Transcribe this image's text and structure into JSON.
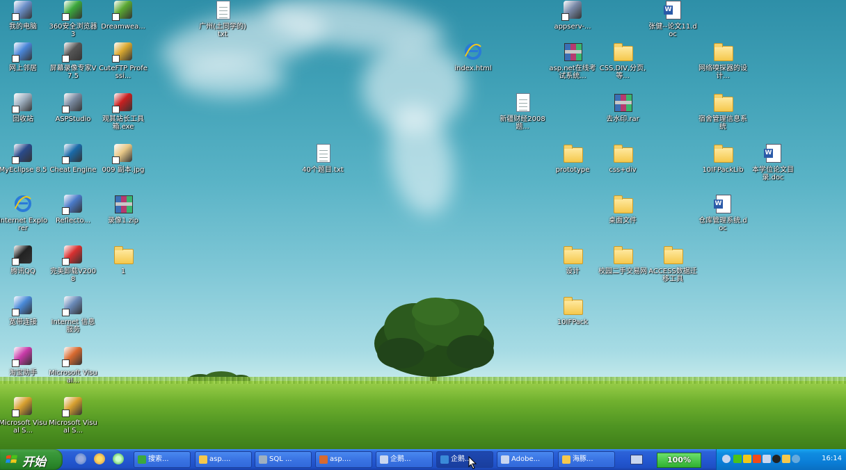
{
  "desktop": {
    "icons": [
      {
        "label": "我的电脑",
        "kind": "generic",
        "color": "#6b8fc9"
      },
      {
        "label": "360安全浏览器 3",
        "kind": "generic",
        "color": "#3ca83c"
      },
      {
        "label": "Dreamwea...",
        "kind": "generic",
        "color": "#5aa832"
      },
      {
        "label": "广州(土同学的) txt",
        "kind": "doc"
      },
      {
        "label": "appserv-...",
        "kind": "generic",
        "color": "#7a8aa8"
      },
      {
        "label": "张健--论文11.doc",
        "kind": "worddoc"
      },
      {
        "label": "网上邻居",
        "kind": "generic",
        "color": "#4a86d8"
      },
      {
        "label": "屏幕录像专家V7.5",
        "kind": "generic",
        "color": "#555555"
      },
      {
        "label": "CuteFTP Professi...",
        "kind": "generic",
        "color": "#d9a830"
      },
      {
        "label": "index.html",
        "kind": "ie"
      },
      {
        "label": "asp.net在线考试系统...",
        "kind": "rar"
      },
      {
        "label": "CSS,DIV,分页,等...",
        "kind": "folder"
      },
      {
        "label": "网络嗅探器的设计...",
        "kind": "folder"
      },
      {
        "label": "回收站",
        "kind": "generic",
        "color": "#9fb0c0"
      },
      {
        "label": "ASPStudio",
        "kind": "generic",
        "color": "#7a8aa0"
      },
      {
        "label": "观其站长工具箱.exe",
        "kind": "generic",
        "color": "#c82020"
      },
      {
        "label": "新疆财经2008题...",
        "kind": "doc"
      },
      {
        "label": "去水印.rar",
        "kind": "rar"
      },
      {
        "label": "宿舍管理信息系统",
        "kind": "folder"
      },
      {
        "label": "MyEclipse 8.5",
        "kind": "generic",
        "color": "#2a4a8a"
      },
      {
        "label": "Cheat Engine",
        "kind": "generic",
        "color": "#1a6aa8"
      },
      {
        "label": "009 副本.jpg",
        "kind": "generic",
        "color": "#e8c888"
      },
      {
        "label": "40个题目.txt",
        "kind": "doc"
      },
      {
        "label": "prototype",
        "kind": "folder"
      },
      {
        "label": "css+div",
        "kind": "folder"
      },
      {
        "label": "10IFPackLib",
        "kind": "folder"
      },
      {
        "label": "本学位论文目录.doc",
        "kind": "worddoc"
      },
      {
        "label": "Internet Explorer",
        "kind": "ie"
      },
      {
        "label": "Reflecto...",
        "kind": "generic",
        "color": "#4a7ac8"
      },
      {
        "label": "录像1.zip",
        "kind": "rar"
      },
      {
        "label": "桌面文件",
        "kind": "folder"
      },
      {
        "label": "仓库管理系统.doc",
        "kind": "worddoc"
      },
      {
        "label": "腾讯QQ",
        "kind": "generic",
        "color": "#222222"
      },
      {
        "label": "完美卸载V2008",
        "kind": "generic",
        "color": "#d83030"
      },
      {
        "label": "1",
        "kind": "folder"
      },
      {
        "label": "设计",
        "kind": "folder"
      },
      {
        "label": "校园二手交易网",
        "kind": "folder"
      },
      {
        "label": "ACCESS数据迁移工具",
        "kind": "folder"
      },
      {
        "label": "宽带连接",
        "kind": "generic",
        "color": "#4a8ad8"
      },
      {
        "label": "Internet 信息服务",
        "kind": "generic",
        "color": "#6a8ab8"
      },
      {
        "label": "10IFPack",
        "kind": "folder"
      },
      {
        "label": "淘宝助手",
        "kind": "generic",
        "color": "#c83aa8"
      },
      {
        "label": "Microsoft Visual...",
        "kind": "generic",
        "color": "#d86a30"
      },
      {
        "label": "Microsoft Visual S...",
        "kind": "generic",
        "color": "#d8a030"
      },
      {
        "label": "Microsoft Visual S...",
        "kind": "generic",
        "color": "#d8a030"
      }
    ]
  },
  "taskbar": {
    "start_label": "开始",
    "tasks": [
      {
        "label": "搜索...",
        "color": "#3ca83c"
      },
      {
        "label": "asp....",
        "color": "#f5c84c"
      },
      {
        "label": "SQL ...",
        "color": "#9fb0c0"
      },
      {
        "label": "asp....",
        "color": "#d86a30"
      },
      {
        "label": "企鹅...",
        "color": "#c9d6ef"
      },
      {
        "label": "企鹅...",
        "color": "#3a8ad8"
      },
      {
        "label": "Adobe...",
        "color": "#c9d6ef"
      },
      {
        "label": "海豚...",
        "color": "#f5c84c"
      }
    ],
    "zoom": "100%",
    "clock": "16:14"
  }
}
